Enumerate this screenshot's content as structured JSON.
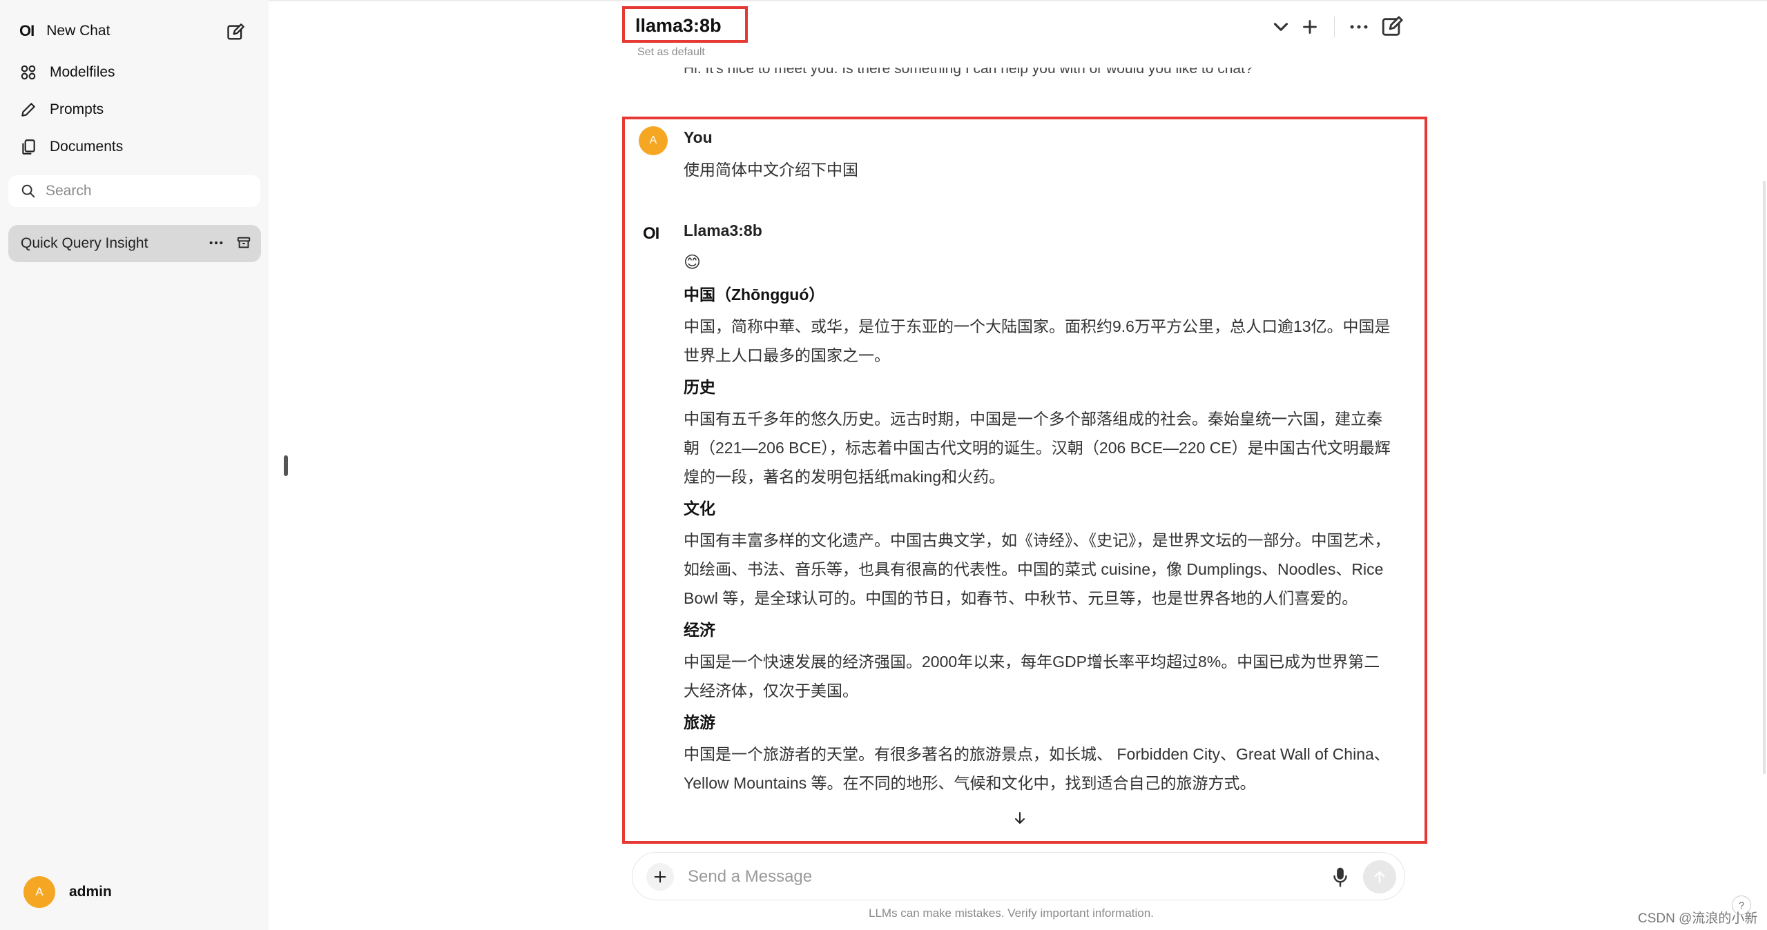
{
  "sidebar": {
    "logo": "OI",
    "new_chat": "New Chat",
    "items": [
      {
        "label": "Modelfiles",
        "icon": "modelfiles-icon"
      },
      {
        "label": "Prompts",
        "icon": "pencil-icon"
      },
      {
        "label": "Documents",
        "icon": "documents-icon"
      }
    ],
    "search_placeholder": "Search",
    "chats": [
      {
        "title": "Quick Query Insight"
      }
    ],
    "user": {
      "initial": "A",
      "name": "admin"
    }
  },
  "header": {
    "model": "llama3:8b",
    "set_default": "Set as default"
  },
  "conversation": {
    "previous_line": "Hi. It's nice to meet you. Is there something I can help you with or would you like to chat?",
    "user": {
      "initial": "A",
      "name": "You",
      "text": "使用简体中文介绍下中国"
    },
    "bot": {
      "logo": "OI",
      "name": "Llama3:8b",
      "emoji": "😊",
      "sections": [
        {
          "heading": "中国（Zhōngguó）",
          "text": "中国，简称中華、或华，是位于东亚的一个大陆国家。面积约9.6万平方公里，总人口逾13亿。中国是世界上人口最多的国家之一。"
        },
        {
          "heading": "历史",
          "text": "中国有五千多年的悠久历史。远古时期，中国是一个多个部落组成的社会。秦始皇统一六国，建立秦朝（221—206 BCE），标志着中国古代文明的诞生。汉朝（206 BCE—220 CE）是中国古代文明最辉煌的一段，著名的发明包括纸making和火药。"
        },
        {
          "heading": "文化",
          "text": "中国有丰富多样的文化遗产。中国古典文学，如《诗经》、《史记》，是世界文坛的一部分。中国艺术，如绘画、书法、音乐等，也具有很高的代表性。中国的菜式 cuisine，像 Dumplings、Noodles、Rice Bowl 等，是全球认可的。中国的节日，如春节、中秋节、元旦等，也是世界各地的人们喜爱的。"
        },
        {
          "heading": "经济",
          "text": "中国是一个快速发展的经济强国。2000年以来，每年GDP增长率平均超过8%。中国已成为世界第二大经济体，仅次于美国。"
        },
        {
          "heading": "旅游",
          "text": "中国是一个旅游者的天堂。有很多著名的旅游景点，如长城、 Forbidden City、Great Wall of China、Yellow Mountains 等。在不同的地形、气候和文化中，找到适合自己的旅游方式。"
        }
      ]
    }
  },
  "composer": {
    "placeholder": "Send a Message"
  },
  "footer": {
    "disclaimer": "LLMs can make mistakes. Verify important information.",
    "watermark": "CSDN @流浪的小新",
    "help": "?"
  },
  "colors": {
    "highlight": "#e53935",
    "avatar": "#f5a623",
    "sidebar_bg": "#f7f7f7"
  }
}
